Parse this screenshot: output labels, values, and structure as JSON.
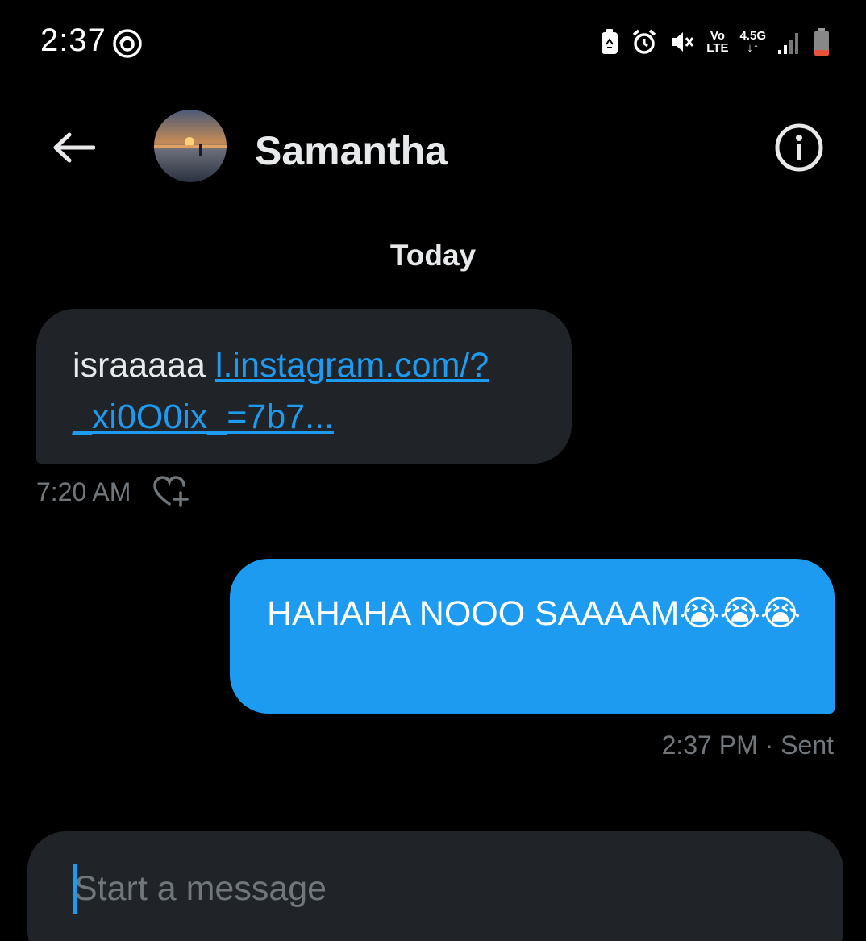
{
  "status_bar": {
    "time": "2:37",
    "network_top": "Vo",
    "network_bottom": "LTE",
    "data_type": "4.5G"
  },
  "header": {
    "contact_name": "Samantha"
  },
  "conversation": {
    "date_label": "Today",
    "incoming": {
      "text": "israaaaa",
      "link_line1": "l.instagram.com/?",
      "link_line2": "_xi0O0ix_=7b7...",
      "time": "7:20 AM"
    },
    "outgoing": {
      "text": "HAHAHA NOOO SAAAAM😭😭😭",
      "meta": "2:37 PM · Sent"
    }
  },
  "composer": {
    "placeholder": "Start a message",
    "value": ""
  },
  "colors": {
    "background": "#000000",
    "bubble_incoming": "#202327",
    "bubble_outgoing": "#1d9bf0",
    "link": "#1d9bf0",
    "muted_text": "#71767b"
  }
}
